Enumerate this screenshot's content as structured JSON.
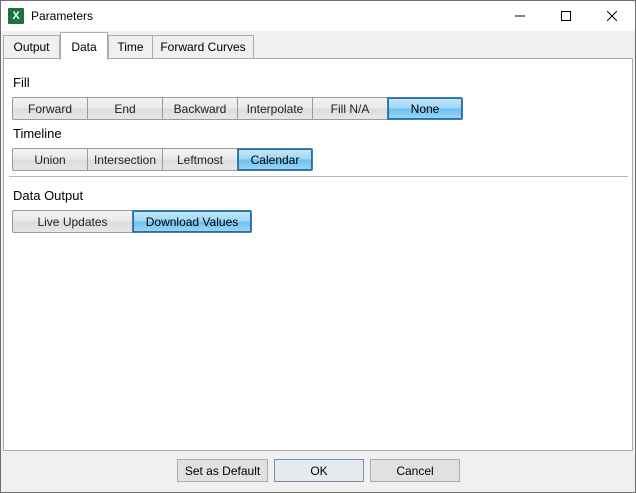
{
  "window": {
    "title": "Parameters",
    "app_icon_letter": "X",
    "app_icon_name": "excel-app-icon",
    "controls": [
      "minimize-icon",
      "maximize-icon",
      "close-icon"
    ]
  },
  "tabs": [
    {
      "label": "Output",
      "active": false
    },
    {
      "label": "Data",
      "active": true
    },
    {
      "label": "Time",
      "active": false
    },
    {
      "label": "Forward Curves",
      "active": false
    }
  ],
  "fill": {
    "label": "Fill",
    "options": [
      "Forward",
      "End",
      "Backward",
      "Interpolate",
      "Fill N/A",
      "None"
    ],
    "selected": "None"
  },
  "timeline": {
    "label": "Timeline",
    "options": [
      "Union",
      "Intersection",
      "Leftmost",
      "Calendar"
    ],
    "selected": "Calendar"
  },
  "data_output": {
    "label": "Data Output",
    "options": [
      "Live Updates",
      "Download Values"
    ],
    "selected": "Download Values"
  },
  "footer": {
    "set_default_label": "Set as Default",
    "ok_label": "OK",
    "cancel_label": "Cancel"
  },
  "colors": {
    "selected_accent": "#6cc0ef",
    "selected_border": "#3c7fb1",
    "excel_green": "#1e7145"
  }
}
